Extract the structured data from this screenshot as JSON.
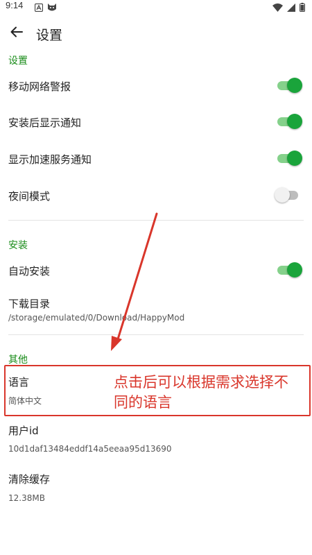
{
  "status_bar": {
    "time": "9:14",
    "left_icons": [
      "notification-a-icon",
      "cat-app-icon"
    ],
    "right_icons": [
      "wifi-icon",
      "signal-icon",
      "battery-icon"
    ]
  },
  "app_bar": {
    "title": "设置",
    "back_icon": "arrow-left-icon"
  },
  "sections": {
    "settings": {
      "title": "设置",
      "items": [
        {
          "label": "移动网络警报",
          "toggle": true
        },
        {
          "label": "安装后显示通知",
          "toggle": true
        },
        {
          "label": "显示加速服务通知",
          "toggle": true
        },
        {
          "label": "夜间模式",
          "toggle": false
        }
      ]
    },
    "install": {
      "title": "安装",
      "auto_install": {
        "label": "自动安装",
        "toggle": true
      },
      "download_dir": {
        "label": "下载目录",
        "value": "/storage/emulated/0/Download/HappyMod"
      }
    },
    "other": {
      "title": "其他",
      "language": {
        "label": "语言",
        "value": "简体中文"
      },
      "user_id": {
        "label": "用户id",
        "value": "10d1daf13484eddf14a5eeaa95d13690"
      },
      "clear_cache": {
        "label": "清除缓存",
        "value": "12.38MB"
      }
    }
  },
  "annotation": {
    "text_line1": "点击后可以根据需求选择不",
    "text_line2": "同的语言"
  },
  "colors": {
    "accent_green": "#1aa43b",
    "section_green": "#1a8c1a",
    "annotation_red": "#d9362b"
  }
}
